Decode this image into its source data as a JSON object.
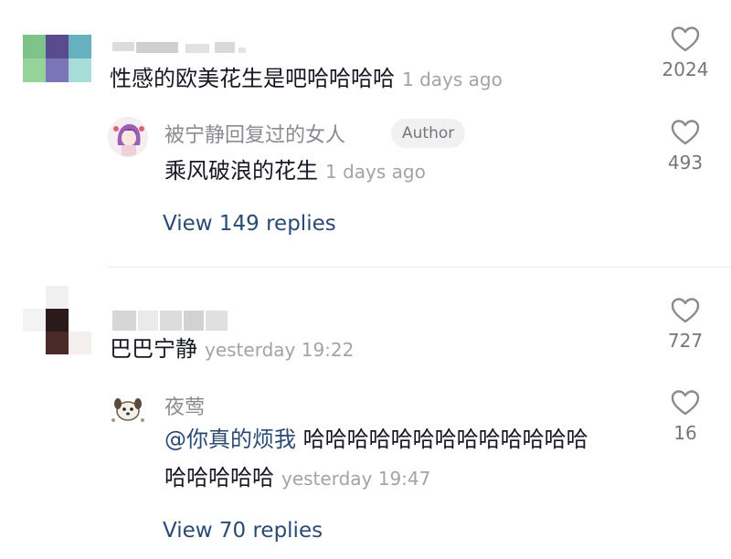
{
  "comments": [
    {
      "text": "性感的欧美花生是吧哈哈哈哈",
      "time": "1 days ago",
      "like_count": "2024",
      "reply": {
        "username": "被宁静回复过的女人",
        "badge": "Author",
        "text": "乘风破浪的花生",
        "time": "1 days ago",
        "like_count": "493"
      },
      "view_replies": "View 149 replies"
    },
    {
      "text": "巴巴宁静",
      "time": "yesterday 19:22",
      "like_count": "727",
      "reply": {
        "username": "夜莺",
        "mention": "@你真的烦我",
        "text_line1": "哈哈哈哈哈哈哈哈哈哈哈哈哈",
        "text_line2": "哈哈哈哈哈",
        "time": "yesterday 19:47",
        "like_count": "16"
      },
      "view_replies": "View 70 replies"
    }
  ],
  "colors": {
    "text": "#161823",
    "secondary": "#8a8b91",
    "link": "#2b4a73",
    "badge_bg": "#f1f1f2"
  },
  "icons": {
    "like": "heart-outline-icon"
  }
}
